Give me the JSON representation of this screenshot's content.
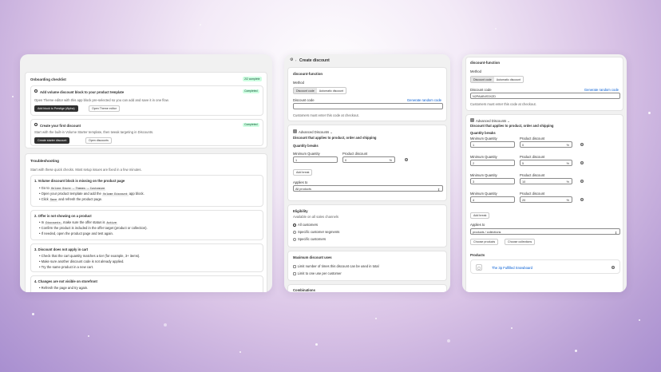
{
  "onboarding": {
    "title": "Onboarding checklist",
    "progress": "2/2 complete",
    "task1_title": "Add volume discount block to your product template",
    "task1_badge": "Completed",
    "task1_desc": "Open Theme editor with this app block pre-selected so you can add and save it in one flow.",
    "task1_btn1": "Add block to Prestige (Alpha)",
    "task1_btn2": "Open Theme editor",
    "task2_title": "Create your first discount",
    "task2_badge": "Completed",
    "task2_desc": "Start with the built-in Volume Starter template, then tweak targeting in Discounts.",
    "task2_btn1": "Create starter discount",
    "task2_btn2": "Open discounts"
  },
  "troubleshooting": {
    "title": "Troubleshooting",
    "intro": "Start with these quick checks. Most setup issues are fixed in a few minutes.",
    "s1_title": "1. Volume discount block is missing on the product page",
    "s1_l1a": "Go to",
    "s1_l1b": "Online Store → Themes → Customize",
    "s1_l2a": "Open your product template and add the",
    "s1_l2b": "Volume Discount",
    "s1_l2c": "app block.",
    "s1_l3a": "Click",
    "s1_l3b": "Save",
    "s1_l3c": "and refresh the product page.",
    "s2_title": "2. Offer is not showing on a product",
    "s2_l1a": "In",
    "s2_l1b": "Discounts",
    "s2_l1c": ", make sure the offer status is",
    "s2_l1d": "Active",
    "s2_l2": "Confirm the product is included in the offer target (product or collection).",
    "s2_l3": "If needed, open the product page and test again.",
    "s3_title": "3. Discount does not apply in cart",
    "s3_l1": "Check that the cart quantity matches a tier (for example, 3+ items).",
    "s3_l2": "Make sure another discount code is not already applied.",
    "s3_l3": "Try the same product in a new cart.",
    "s4_title": "4. Changes are not visible on storefront",
    "s4_l1": "Refresh the page and try again."
  },
  "create": {
    "header_title": "Create discount",
    "section_title": "discount-function",
    "method_label": "Method",
    "method_code": "Discount code",
    "method_auto": "Automatic discount",
    "code_label": "Discount code",
    "generate_link": "Generate random code",
    "code_value": "",
    "code_help": "Customers must enter this code at checkout.",
    "adv_title": "Advanced Discounts",
    "adv_subtitle": "Discount that applies to product, order and shipping",
    "qb_label": "Quantity breaks",
    "min_qty_label": "Minimum Quantity",
    "prod_disc_label": "Product discount",
    "tier_qty": "1",
    "tier_disc": "0",
    "percent": "%",
    "add_break": "Add break",
    "applies_label": "Applies to",
    "applies_value": "All products",
    "elig_title": "Eligibility",
    "elig_sub": "Available on all sales channels",
    "elig_opt1": "All customers",
    "elig_opt2": "Specific customer segments",
    "elig_opt3": "Specific customers",
    "max_title": "Maximum discount uses",
    "max_opt1": "Limit number of times this discount can be used in total",
    "max_opt2": "Limit to one use per customer",
    "comb_title": "Combinations"
  },
  "right": {
    "section_title": "discount-function",
    "method_label": "Method",
    "method_code": "Discount code",
    "method_auto": "Automatic discount",
    "code_label": "Discount code",
    "generate_link": "Generate random code",
    "code_value": "N2PAAB4S3XZD",
    "code_help": "Customers must enter this code at checkout.",
    "adv_title": "Advanced Discounts",
    "adv_subtitle": "Discount that applies to product, order and shipping",
    "qb_label": "Quantity breaks",
    "min_qty_label": "Minimum Quantity",
    "prod_disc_label": "Product discount",
    "percent": "%",
    "tiers": [
      {
        "qty": "1",
        "disc": "0"
      },
      {
        "qty": "2",
        "disc": "5"
      },
      {
        "qty": "3",
        "disc": "10"
      },
      {
        "qty": "4",
        "disc": "20"
      }
    ],
    "add_break": "Add break",
    "applies_label": "Applies to",
    "applies_value": "products / collections",
    "choose_products": "Choose products",
    "choose_collections": "Choose collections",
    "products_label": "Products",
    "product_name": "The 3p Fulfilled Snowboard"
  }
}
